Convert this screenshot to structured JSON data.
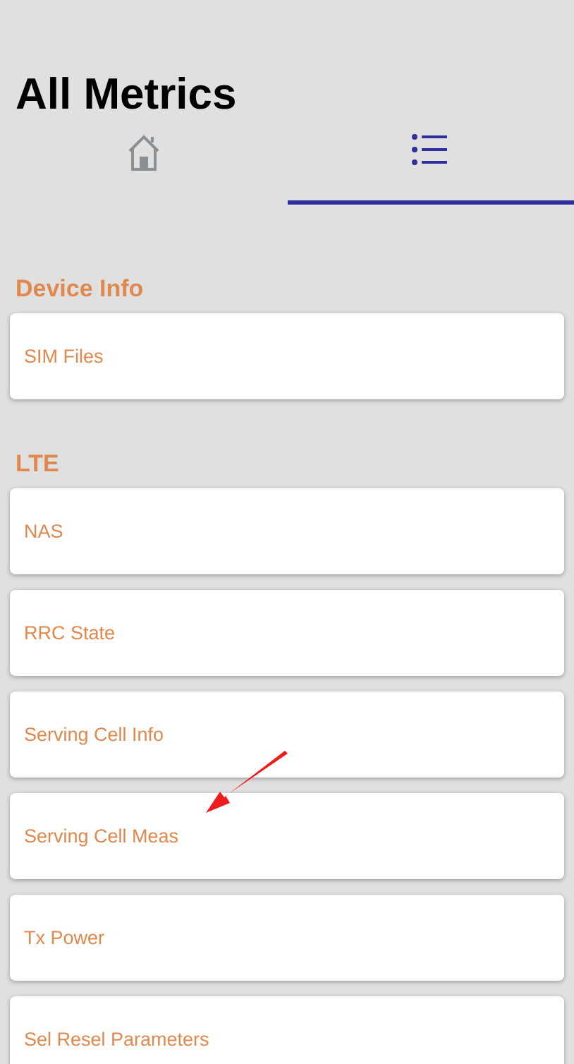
{
  "title": "All Metrics",
  "tabs": [
    {
      "kind": "home",
      "selected": false
    },
    {
      "kind": "list",
      "selected": true
    }
  ],
  "sections": [
    {
      "heading": "Device Info",
      "items": [
        "SIM Files"
      ]
    },
    {
      "heading": "LTE",
      "items": [
        "NAS",
        "RRC State",
        "Serving Cell Info",
        "Serving Cell Meas",
        "Tx Power",
        "Sel Resel Parameters"
      ]
    }
  ]
}
